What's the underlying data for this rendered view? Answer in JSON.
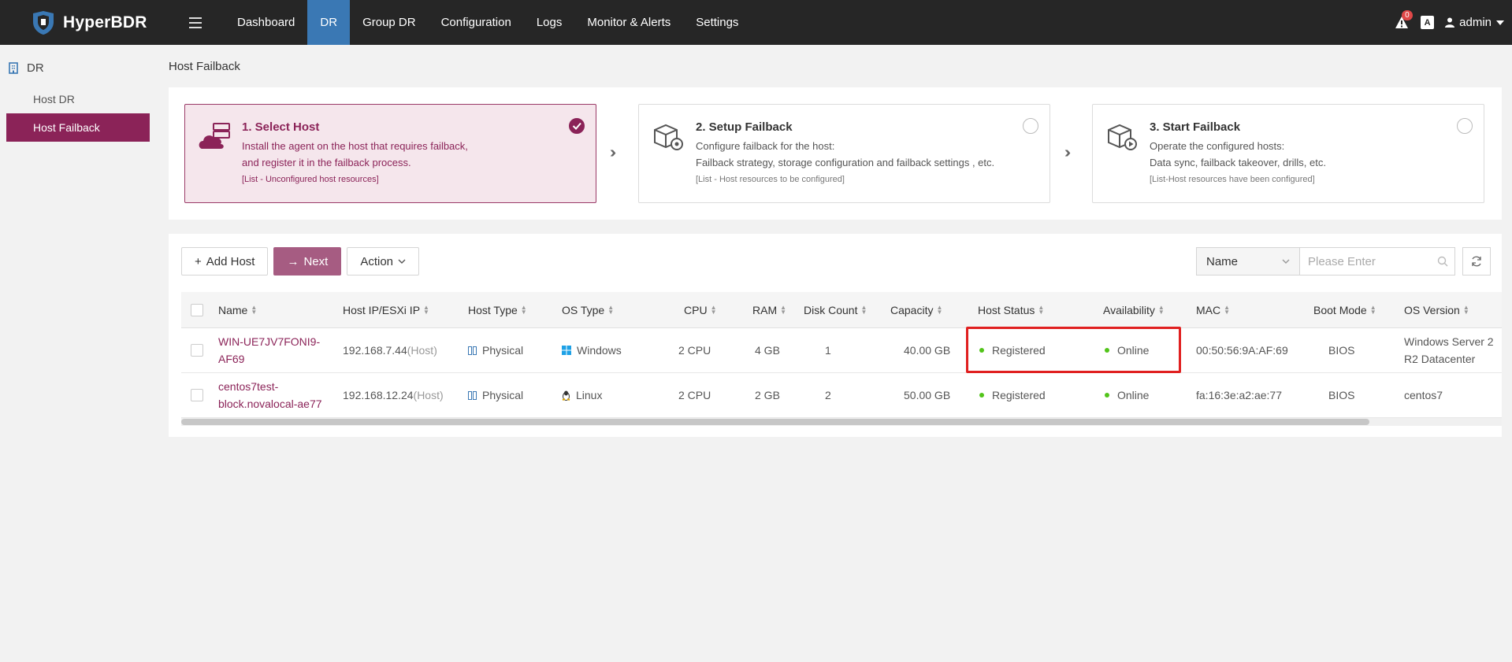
{
  "app": {
    "name": "HyperBDR"
  },
  "nav": {
    "items": [
      {
        "label": "Dashboard"
      },
      {
        "label": "DR"
      },
      {
        "label": "Group DR"
      },
      {
        "label": "Configuration"
      },
      {
        "label": "Logs"
      },
      {
        "label": "Monitor & Alerts"
      },
      {
        "label": "Settings"
      }
    ],
    "active": "DR",
    "alert_count": "0",
    "lang_icon": "A",
    "user": "admin"
  },
  "sidebar": {
    "group": "DR",
    "items": [
      {
        "label": "Host DR"
      },
      {
        "label": "Host Failback"
      }
    ]
  },
  "page": {
    "title": "Host Failback"
  },
  "steps": [
    {
      "title": "1. Select Host",
      "desc_line1": "Install the agent on the host that requires failback,",
      "desc_line2": "and register it in the failback process.",
      "note": "[List - Unconfigured host resources]",
      "checked": true
    },
    {
      "title": "2. Setup Failback",
      "desc_line1": "Configure failback for the host:",
      "desc_line2": "Failback strategy, storage configuration and failback settings , etc.",
      "note": "[List - Host resources to be configured]",
      "checked": false
    },
    {
      "title": "3. Start Failback",
      "desc_line1": "Operate the configured hosts:",
      "desc_line2": "Data sync, failback takeover, drills, etc.",
      "note": "[List-Host resources have been configured]",
      "checked": false
    }
  ],
  "toolbar": {
    "add_host": "Add Host",
    "next": "Next",
    "action": "Action",
    "search_field": "Name",
    "search_placeholder": "Please Enter"
  },
  "table": {
    "columns": [
      "Name",
      "Host IP/ESXi IP",
      "Host Type",
      "OS Type",
      "CPU",
      "RAM",
      "Disk Count",
      "Capacity",
      "Host Status",
      "Availability",
      "MAC",
      "Boot Mode",
      "OS Version"
    ],
    "rows": [
      {
        "name_line1": "WIN-UE7JV7FONI9-",
        "name_line2": "AF69",
        "ip": "192.168.7.44",
        "ip_tag": "(Host)",
        "host_type": "Physical",
        "os_type": "Windows",
        "os_icon": "windows-icon",
        "cpu": "2 CPU",
        "ram": "4 GB",
        "disk_count": "1",
        "capacity": "40.00 GB",
        "host_status": "Registered",
        "availability": "Online",
        "mac": "00:50:56:9A:AF:69",
        "boot_mode": "BIOS",
        "os_version_line1": "Windows Server 2",
        "os_version_line2": "R2 Datacenter"
      },
      {
        "name_line1": "centos7test-",
        "name_line2": "block.novalocal-ae77",
        "ip": "192.168.12.24",
        "ip_tag": "(Host)",
        "host_type": "Physical",
        "os_type": "Linux",
        "os_icon": "linux-icon",
        "cpu": "2 CPU",
        "ram": "2 GB",
        "disk_count": "2",
        "capacity": "50.00 GB",
        "host_status": "Registered",
        "availability": "Online",
        "mac": "fa:16:3e:a2:ae:77",
        "boot_mode": "BIOS",
        "os_version_line1": "centos7",
        "os_version_line2": ""
      }
    ]
  },
  "colors": {
    "accent": "#8b2358",
    "nav_active": "#3a78b4",
    "online": "#52c41a",
    "highlight": "#e02020"
  }
}
